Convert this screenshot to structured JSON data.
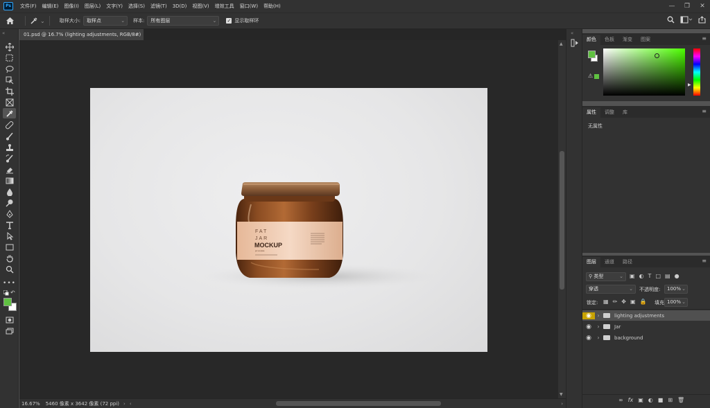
{
  "menubar": {
    "logo": "Ps",
    "items": [
      "文件(F)",
      "编辑(E)",
      "图像(I)",
      "图层(L)",
      "文字(Y)",
      "选择(S)",
      "滤镜(T)",
      "3D(D)",
      "视图(V)",
      "增效工具",
      "窗口(W)",
      "帮助(H)"
    ]
  },
  "options": {
    "sample_size_label": "取样大小:",
    "sample_size_value": "取样点",
    "sample_label": "样本:",
    "sample_value": "所有图层",
    "show_ring_label": "显示取样环"
  },
  "document": {
    "tab_title": "01.psd @ 16.7% (lighting adjustments, RGB/8#)",
    "zoom": "16.67%",
    "dimensions": "5460 像素 x 3642 像素 (72 ppi)",
    "jar_label": {
      "line1": "FAT",
      "line2": "JAR",
      "line3": "MOCKUP",
      "small": "jar template"
    }
  },
  "panels": {
    "color_tabs": [
      "颜色",
      "色板",
      "渐变",
      "图案"
    ],
    "properties_tabs": [
      "属性",
      "调整",
      "库"
    ],
    "properties_empty": "无属性",
    "layers_tabs": [
      "图层",
      "通道",
      "路径"
    ],
    "filter_kind": "类型",
    "blend_mode": "穿透",
    "opacity_label": "不透明度:",
    "opacity_value": "100%",
    "lock_label": "锁定:",
    "fill_label": "填充:",
    "fill_value": "100%",
    "layers": [
      {
        "name": "lighting adjustments"
      },
      {
        "name": "Jar"
      },
      {
        "name": "background"
      }
    ]
  },
  "colors": {
    "foreground": "#5fc141",
    "background": "#ffffff",
    "picker_hue": "#4cff00",
    "highlight_row": "#c7a200"
  }
}
